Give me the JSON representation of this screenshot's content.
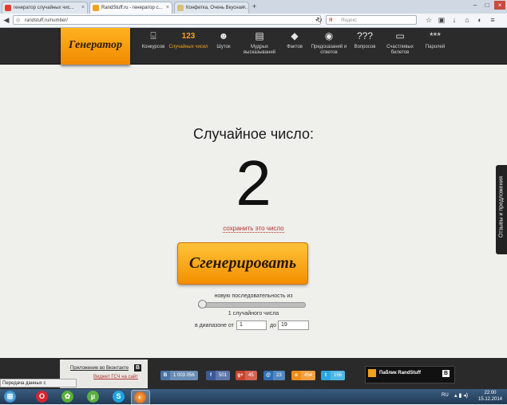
{
  "browser": {
    "tabs": [
      {
        "title": "генератор случайных чис..."
      },
      {
        "title": "RandStuff.ru - генератор с..."
      },
      {
        "title": "Конфетка, Очень Вкусная..."
      }
    ],
    "new_tab": "+",
    "url": "randstuff.ru/number/",
    "search_placeholder": "Яндекс"
  },
  "site": {
    "logo": "Генератор",
    "menu": [
      {
        "label": "Конкурсов",
        "icon": "gift-icon"
      },
      {
        "label": "Случайных чисел",
        "icon": "numbers-icon",
        "glyph": "123"
      },
      {
        "label": "Шуток",
        "icon": "smile-icon"
      },
      {
        "label": "Мудрых высказываний",
        "icon": "quote-icon"
      },
      {
        "label": "Фактов",
        "icon": "exclamation-icon"
      },
      {
        "label": "Предсказаний и ответов",
        "icon": "ball-icon"
      },
      {
        "label": "Вопросов",
        "icon": "question-icon",
        "glyph": "???"
      },
      {
        "label": "Счастливых билетов",
        "icon": "ticket-icon"
      },
      {
        "label": "Паролей",
        "icon": "password-icon",
        "glyph": "***"
      }
    ]
  },
  "main": {
    "heading": "Случайное число:",
    "number": "2",
    "save_link": "сохранить это число",
    "generate_button": "Сгенерировать",
    "sequence_label": "новую последовательность из",
    "count_label": "1 случайного числа",
    "range_label_from": "в диапазоне от",
    "range_from": "1",
    "range_label_to": "до",
    "range_to": "19",
    "slider_value": 1
  },
  "feedback_tab": "Отзывы и предложения",
  "footer": {
    "app_link": "Приложение во Вконтакте",
    "widget_link": "Виджет ГСЧ на сайт",
    "vk_letter": "В",
    "social": [
      {
        "name": "vkontakte",
        "icon": "vk-icon",
        "glyph": "B",
        "count": "1 003 056",
        "color": "#4b74a5"
      },
      {
        "name": "facebook",
        "icon": "facebook-icon",
        "glyph": "f",
        "count": "501",
        "color": "#3b5998"
      },
      {
        "name": "google-plus",
        "icon": "gplus-icon",
        "glyph": "g+",
        "count": "45",
        "color": "#c9432f"
      },
      {
        "name": "mail",
        "icon": "mail-icon",
        "glyph": "@",
        "count": "23",
        "color": "#2d6fb5"
      },
      {
        "name": "odnoklassniki",
        "icon": "ok-icon",
        "glyph": "о",
        "count": "454",
        "color": "#f08c16"
      },
      {
        "name": "twitter",
        "icon": "twitter-icon",
        "glyph": "t",
        "count": "156",
        "color": "#2aa8e0"
      }
    ],
    "public_label": "Паблик RandStuff",
    "public_letter": "В"
  },
  "status_text": "Передача данных с mc.yandex.ru...",
  "taskbar": {
    "lang": "RU",
    "time": "22:00",
    "date": "15.12.2014"
  }
}
